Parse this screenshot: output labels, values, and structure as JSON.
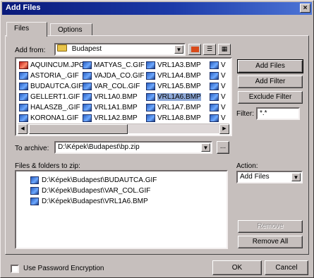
{
  "window": {
    "title": "Add Files",
    "close_glyph": "×"
  },
  "tabs": [
    {
      "label": "Files"
    },
    {
      "label": "Options"
    }
  ],
  "add_from": {
    "label": "Add from:",
    "value": "Budapest"
  },
  "file_columns": [
    [
      {
        "name": "AQUINCUM.JPG",
        "icon": "red"
      },
      {
        "name": "ASTORIA_.GIF",
        "icon": "blue"
      },
      {
        "name": "BUDAUTCA.GIF",
        "icon": "blue"
      },
      {
        "name": "GELLERT1.GIF",
        "icon": "blue"
      },
      {
        "name": "HALASZB_.GIF",
        "icon": "blue"
      },
      {
        "name": "KORONA1.GIF",
        "icon": "blue"
      }
    ],
    [
      {
        "name": "MATYAS_C.GIF",
        "icon": "blue"
      },
      {
        "name": "VAJDA_CO.GIF",
        "icon": "blue"
      },
      {
        "name": "VAR_COL.GIF",
        "icon": "blue"
      },
      {
        "name": "VRL1A0.BMP",
        "icon": "blue"
      },
      {
        "name": "VRL1A1.BMP",
        "icon": "blue"
      },
      {
        "name": "VRL1A2.BMP",
        "icon": "blue"
      }
    ],
    [
      {
        "name": "VRL1A3.BMP",
        "icon": "blue"
      },
      {
        "name": "VRL1A4.BMP",
        "icon": "blue"
      },
      {
        "name": "VRL1A5.BMP",
        "icon": "blue"
      },
      {
        "name": "VRL1A6.BMP",
        "icon": "blue",
        "selected": true
      },
      {
        "name": "VRL1A7.BMP",
        "icon": "blue"
      },
      {
        "name": "VRL1A8.BMP",
        "icon": "blue"
      }
    ],
    [
      {
        "name": "V",
        "icon": "blue"
      },
      {
        "name": "V",
        "icon": "blue"
      },
      {
        "name": "V",
        "icon": "blue"
      },
      {
        "name": "V",
        "icon": "blue"
      },
      {
        "name": "V",
        "icon": "blue"
      },
      {
        "name": "V",
        "icon": "blue"
      }
    ]
  ],
  "buttons": {
    "add_files": "Add Files",
    "add_filter": "Add Filter",
    "exclude_filter": "Exclude Filter",
    "remove": "Remove",
    "remove_all": "Remove All",
    "ok": "OK",
    "cancel": "Cancel",
    "browse": "..."
  },
  "filter": {
    "label": "Filter:",
    "value": "*.*"
  },
  "to_archive": {
    "label": "To archive:",
    "value": "D:\\Képek\\Budapest\\bp.zip"
  },
  "files_to_zip": {
    "label": "Files & folders to zip:",
    "items": [
      "D:\\Képek\\Budapest\\BUDAUTCA.GIF",
      "D:\\Képek\\Budapest\\VAR_COL.GIF",
      "D:\\Képek\\Budapest\\VRL1A6.BMP"
    ]
  },
  "action": {
    "label": "Action:",
    "value": "Add Files"
  },
  "password": {
    "label": "Use Password Encryption",
    "checked": false
  },
  "glyphs": {
    "combo_arrow": "▼",
    "scroll_left": "◀",
    "scroll_right": "▶"
  }
}
